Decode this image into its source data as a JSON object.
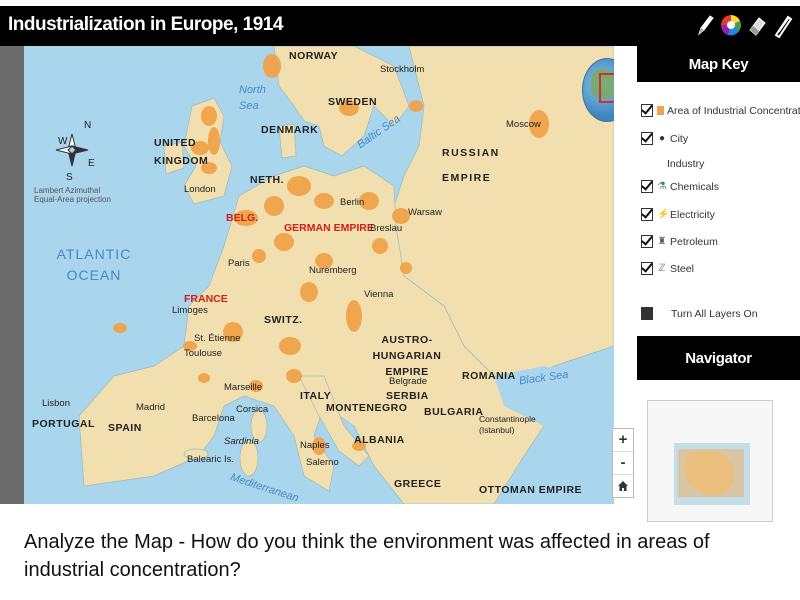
{
  "title": "Industrialization in Europe, 1914",
  "tools": [
    {
      "name": "pencil-icon"
    },
    {
      "name": "color-wheel-icon"
    },
    {
      "name": "eraser-icon"
    },
    {
      "name": "marker-icon"
    }
  ],
  "map": {
    "countries": [
      "NORWAY",
      "SWEDEN",
      "DENMARK",
      "UNITED KINGDOM",
      "RUSSIAN EMPIRE",
      "NETH.",
      "BELG.",
      "GERMAN EMPIRE",
      "FRANCE",
      "SWITZ.",
      "AUSTRO-HUNGARIAN EMPIRE",
      "ITALY",
      "MONTENEGRO",
      "SERBIA",
      "ROMANIA",
      "BULGARIA",
      "ALBANIA",
      "GREECE",
      "OTTOMAN EMPIRE",
      "PORTUGAL",
      "SPAIN"
    ],
    "seas": [
      "North Sea",
      "Baltic Sea",
      "Black Sea",
      "Mediterranean"
    ],
    "ocean": "ATLANTIC OCEAN",
    "cities": [
      "Stockholm",
      "Moscow",
      "London",
      "Berlin",
      "Warsaw",
      "Breslau",
      "Paris",
      "Nuremberg",
      "Vienna",
      "Limoges",
      "St. Étienne",
      "Toulouse",
      "Marseille",
      "Belgrade",
      "Lisbon",
      "Madrid",
      "Barcelona",
      "Corsica",
      "Sardinia",
      "Balearic Is.",
      "Naples",
      "Salerno",
      "Constantinople (Istanbul)"
    ],
    "projection_note": "Lambert Azimuthal Equal-Area projection",
    "compass": [
      "N",
      "E",
      "S",
      "W"
    ],
    "land_color": "#f2dfaf",
    "concentration_color": "#f0a24a",
    "water_color": "#a9d6ec"
  },
  "zoom": {
    "plus": "+",
    "minus": "-",
    "home": "home-icon"
  },
  "panel": {
    "map_key_title": "Map Key",
    "layers": [
      {
        "label": "Area of Industrial Concentration",
        "checked": true,
        "symbol": "swatch",
        "color": "#f0a24a"
      },
      {
        "label": "City",
        "checked": true,
        "symbol": "dot",
        "color": "#111111"
      }
    ],
    "industry_heading": "Industry",
    "industries": [
      {
        "label": "Chemicals",
        "checked": true,
        "color": "#2e8b57"
      },
      {
        "label": "Electricity",
        "checked": true,
        "color": "#e6b800"
      },
      {
        "label": "Petroleum",
        "checked": true,
        "color": "#555555"
      },
      {
        "label": "Steel",
        "checked": true,
        "color": "#777777"
      }
    ],
    "turn_all_layers": "Turn All Layers On",
    "navigator_title": "Navigator"
  },
  "question": "Analyze the Map - How do you think the environment was affected in areas of industrial concentration?"
}
